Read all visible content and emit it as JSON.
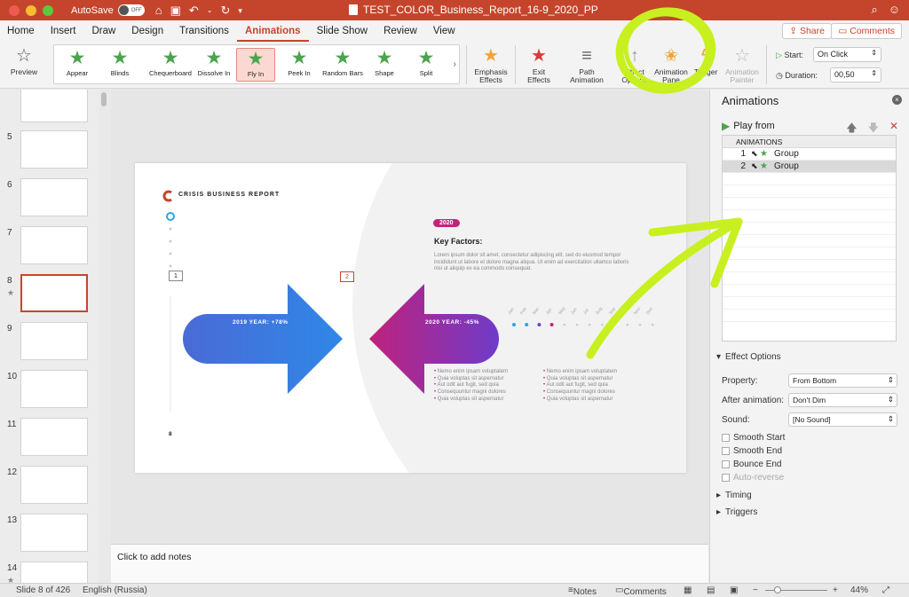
{
  "titlebar": {
    "autosave_label": "AutoSave",
    "toggle_label": "OFF",
    "doc_title": "TEST_COLOR_Business_Report_16-9_2020_PP"
  },
  "tabs": [
    "Home",
    "Insert",
    "Draw",
    "Design",
    "Transitions",
    "Animations",
    "Slide Show",
    "Review",
    "View"
  ],
  "active_tab": "Animations",
  "share_label": "Share",
  "comments_label": "Comments",
  "ribbon": {
    "preview_label": "Preview",
    "gallery": [
      "Appear",
      "Blinds",
      "Chequerboard",
      "Dissolve In",
      "Fly In",
      "Peek In",
      "Random Bars",
      "Shape",
      "Split"
    ],
    "selected_effect": "Fly In",
    "emphasis_label": "Emphasis Effects",
    "exit_label": "Exit Effects",
    "path_label": "Path Animation",
    "effect_options_label": "Effect Options",
    "animation_pane_label": "Animation Pane",
    "trigger_label": "Trigger",
    "painter_label": "Animation Painter",
    "start_label": "Start:",
    "start_value": "On Click",
    "duration_label": "Duration:",
    "duration_value": "00,50"
  },
  "thumbnails": [
    {
      "num": "",
      "star": false
    },
    {
      "num": "5",
      "star": false
    },
    {
      "num": "6",
      "star": false
    },
    {
      "num": "7",
      "star": false
    },
    {
      "num": "8",
      "star": true
    },
    {
      "num": "9",
      "star": false
    },
    {
      "num": "10",
      "star": false
    },
    {
      "num": "11",
      "star": false
    },
    {
      "num": "12",
      "star": false
    },
    {
      "num": "13",
      "star": false
    },
    {
      "num": "14",
      "star": true
    }
  ],
  "selected_slide": "8",
  "slide": {
    "brand": "CRISIS BUSINESS REPORT",
    "badge1": "1",
    "badge2": "2",
    "arrow_left_label": "2019 YEAR: +78%",
    "arrow_right_label": "2020 YEAR: -45%",
    "year_tag": "2020",
    "heading": "Key Factors:",
    "body": "Lorem ipsum dolor sit amet, consectetur adipiscing elit, sed do eiusmod tempor incididunt ut labore et dolore magna aliqua. Ut enim ad exercitation ullamco laboris nisi ut aliquip ex ea commodo consequat.",
    "months": [
      "Jan",
      "Feb",
      "Mar",
      "Apr",
      "May",
      "Jun",
      "Jul",
      "Aug",
      "Sep",
      "Oct",
      "Nov",
      "Dec"
    ],
    "bullets_left": [
      "Nemo enim ipsam voluptatem",
      "Quia voluptas sit aspernatur",
      "Aut odit aut fugit, sed quia",
      "Consequuntur magni dolores",
      "Quia voluptas sit aspernatur"
    ],
    "bullets_right": [
      "Nemo enim ipsam voluptatem",
      "Quia voluptas sit aspernatur",
      "Aut odit aut fugit, sed quia",
      "Consequuntur magni dolores",
      "Quia voluptas sit aspernatur"
    ],
    "slide_number": "8",
    "colors": {
      "blue": "#2d6fdc",
      "magenta": "#c2247a",
      "purple": "#7a3fc4",
      "accent": "#c5452c"
    }
  },
  "notes_placeholder": "Click to add notes",
  "pane": {
    "title": "Animations",
    "play_from": "Play from",
    "list_header": "ANIMATIONS",
    "items": [
      {
        "num": "1",
        "name": "Group"
      },
      {
        "num": "2",
        "name": "Group"
      }
    ],
    "effect_options_title": "Effect Options",
    "property_label": "Property:",
    "property_value": "From Bottom",
    "after_label": "After animation:",
    "after_value": "Don't Dim",
    "sound_label": "Sound:",
    "sound_value": "[No Sound]",
    "smooth_start": "Smooth Start",
    "smooth_end": "Smooth End",
    "bounce_end": "Bounce End",
    "auto_reverse": "Auto-reverse",
    "timing_title": "Timing",
    "triggers_title": "Triggers"
  },
  "status": {
    "slide_info": "Slide 8 of 426",
    "language": "English (Russia)",
    "notes": "Notes",
    "comments": "Comments",
    "zoom": "44%"
  },
  "highlight_color": "#c8f020"
}
